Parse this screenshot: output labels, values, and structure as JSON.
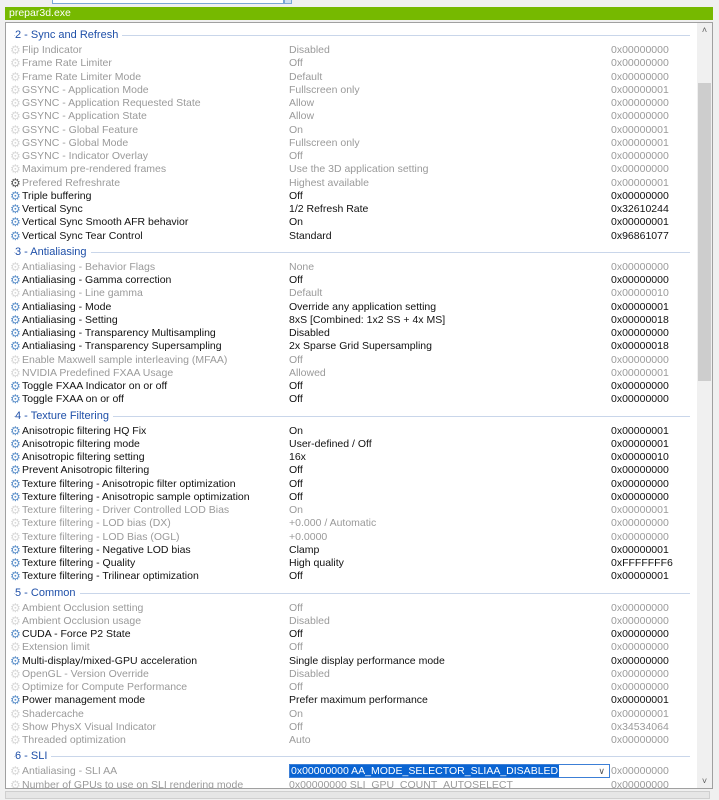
{
  "profile": {
    "name": "prepar3d.exe"
  },
  "colors": {
    "brand": "#76b900",
    "section": "#1e4fa8",
    "modified_icon": "#5b8fc9",
    "selection": "#0a64d2"
  },
  "icons": {
    "setting": "gear-icon",
    "scroll_up": "chevron-up-icon",
    "scroll_down": "chevron-down-icon"
  },
  "sections": [
    {
      "title": "2 - Sync and Refresh",
      "rows": [
        {
          "name": "Flip Indicator",
          "value": "Disabled",
          "hex": "0x00000000",
          "state": "default"
        },
        {
          "name": "Frame Rate Limiter",
          "value": "Off",
          "hex": "0x00000000",
          "state": "default"
        },
        {
          "name": "Frame Rate Limiter Mode",
          "value": "Default",
          "hex": "0x00000000",
          "state": "default"
        },
        {
          "name": "GSYNC - Application Mode",
          "value": "Fullscreen only",
          "hex": "0x00000001",
          "state": "default"
        },
        {
          "name": "GSYNC - Application Requested State",
          "value": "Allow",
          "hex": "0x00000000",
          "state": "default"
        },
        {
          "name": "GSYNC - Application State",
          "value": "Allow",
          "hex": "0x00000000",
          "state": "default"
        },
        {
          "name": "GSYNC - Global Feature",
          "value": "On",
          "hex": "0x00000001",
          "state": "default"
        },
        {
          "name": "GSYNC - Global Mode",
          "value": "Fullscreen only",
          "hex": "0x00000001",
          "state": "default"
        },
        {
          "name": "GSYNC - Indicator Overlay",
          "value": "Off",
          "hex": "0x00000000",
          "state": "default"
        },
        {
          "name": "Maximum pre-rendered frames",
          "value": "Use the 3D application setting",
          "hex": "0x00000000",
          "state": "default"
        },
        {
          "name": "Prefered Refreshrate",
          "value": "Highest available",
          "hex": "0x00000001",
          "state": "pref"
        },
        {
          "name": "Triple buffering",
          "value": "Off",
          "hex": "0x00000000",
          "state": "mod"
        },
        {
          "name": "Vertical Sync",
          "value": "1/2 Refresh Rate",
          "hex": "0x32610244",
          "state": "mod"
        },
        {
          "name": "Vertical Sync Smooth AFR behavior",
          "value": "On",
          "hex": "0x00000001",
          "state": "mod"
        },
        {
          "name": "Vertical Sync Tear Control",
          "value": "Standard",
          "hex": "0x96861077",
          "state": "mod"
        }
      ]
    },
    {
      "title": "3 - Antialiasing",
      "rows": [
        {
          "name": "Antialiasing - Behavior Flags",
          "value": "None",
          "hex": "0x00000000",
          "state": "default"
        },
        {
          "name": "Antialiasing - Gamma correction",
          "value": "Off",
          "hex": "0x00000000",
          "state": "mod"
        },
        {
          "name": "Antialiasing - Line gamma",
          "value": "Default",
          "hex": "0x00000010",
          "state": "default"
        },
        {
          "name": "Antialiasing - Mode",
          "value": "Override any application setting",
          "hex": "0x00000001",
          "state": "mod"
        },
        {
          "name": "Antialiasing - Setting",
          "value": "8xS [Combined: 1x2 SS + 4x MS]",
          "hex": "0x00000018",
          "state": "mod"
        },
        {
          "name": "Antialiasing - Transparency Multisampling",
          "value": "Disabled",
          "hex": "0x00000000",
          "state": "mod"
        },
        {
          "name": "Antialiasing - Transparency Supersampling",
          "value": "2x Sparse Grid Supersampling",
          "hex": "0x00000018",
          "state": "mod"
        },
        {
          "name": "Enable Maxwell sample interleaving (MFAA)",
          "value": "Off",
          "hex": "0x00000000",
          "state": "default"
        },
        {
          "name": "NVIDIA Predefined FXAA Usage",
          "value": "Allowed",
          "hex": "0x00000001",
          "state": "default"
        },
        {
          "name": "Toggle FXAA Indicator on or off",
          "value": "Off",
          "hex": "0x00000000",
          "state": "mod"
        },
        {
          "name": "Toggle FXAA on or off",
          "value": "Off",
          "hex": "0x00000000",
          "state": "mod"
        }
      ]
    },
    {
      "title": "4 - Texture Filtering",
      "rows": [
        {
          "name": "Anisotropic filtering HQ Fix",
          "value": "On",
          "hex": "0x00000001",
          "state": "mod"
        },
        {
          "name": "Anisotropic filtering mode",
          "value": "User-defined / Off",
          "hex": "0x00000001",
          "state": "mod"
        },
        {
          "name": "Anisotropic filtering setting",
          "value": "16x",
          "hex": "0x00000010",
          "state": "mod"
        },
        {
          "name": "Prevent Anisotropic filtering",
          "value": "Off",
          "hex": "0x00000000",
          "state": "mod"
        },
        {
          "name": "Texture filtering - Anisotropic filter optimization",
          "value": "Off",
          "hex": "0x00000000",
          "state": "mod"
        },
        {
          "name": "Texture filtering - Anisotropic sample optimization",
          "value": "Off",
          "hex": "0x00000000",
          "state": "mod"
        },
        {
          "name": "Texture filtering - Driver Controlled LOD Bias",
          "value": "On",
          "hex": "0x00000001",
          "state": "default"
        },
        {
          "name": "Texture filtering - LOD bias (DX)",
          "value": "+0.000 / Automatic",
          "hex": "0x00000000",
          "state": "default"
        },
        {
          "name": "Texture filtering - LOD Bias (OGL)",
          "value": "+0.0000",
          "hex": "0x00000000",
          "state": "default"
        },
        {
          "name": "Texture filtering - Negative LOD bias",
          "value": "Clamp",
          "hex": "0x00000001",
          "state": "mod"
        },
        {
          "name": "Texture filtering - Quality",
          "value": "High quality",
          "hex": "0xFFFFFFF6",
          "state": "mod"
        },
        {
          "name": "Texture filtering - Trilinear optimization",
          "value": "Off",
          "hex": "0x00000001",
          "state": "mod"
        }
      ]
    },
    {
      "title": "5 - Common",
      "rows": [
        {
          "name": "Ambient Occlusion setting",
          "value": "Off",
          "hex": "0x00000000",
          "state": "default"
        },
        {
          "name": "Ambient Occlusion usage",
          "value": "Disabled",
          "hex": "0x00000000",
          "state": "default"
        },
        {
          "name": "CUDA - Force P2 State",
          "value": "Off",
          "hex": "0x00000000",
          "state": "mod"
        },
        {
          "name": "Extension limit",
          "value": "Off",
          "hex": "0x00000000",
          "state": "default"
        },
        {
          "name": "Multi-display/mixed-GPU acceleration",
          "value": "Single display performance mode",
          "hex": "0x00000000",
          "state": "mod"
        },
        {
          "name": "OpenGL - Version Override",
          "value": "Disabled",
          "hex": "0x00000000",
          "state": "default"
        },
        {
          "name": "Optimize for Compute Performance",
          "value": "Off",
          "hex": "0x00000000",
          "state": "default"
        },
        {
          "name": "Power management mode",
          "value": "Prefer maximum performance",
          "hex": "0x00000001",
          "state": "mod"
        },
        {
          "name": "Shadercache",
          "value": "On",
          "hex": "0x00000001",
          "state": "default"
        },
        {
          "name": "Show PhysX Visual Indicator",
          "value": "Off",
          "hex": "0x34534064",
          "state": "default"
        },
        {
          "name": "Threaded optimization",
          "value": "Auto",
          "hex": "0x00000000",
          "state": "default"
        }
      ]
    },
    {
      "title": "6 - SLI",
      "rows": [
        {
          "name": "Antialiasing - SLI AA",
          "value": "0x00000000 AA_MODE_SELECTOR_SLIAA_DISABLED",
          "hex": "0x00000000",
          "state": "default",
          "editing": true
        },
        {
          "name": "Number of GPUs to use on SLI rendering mode",
          "value": "0x00000000 SLI_GPU_COUNT_AUTOSELECT",
          "hex": "0x00000000",
          "state": "default"
        }
      ]
    }
  ]
}
